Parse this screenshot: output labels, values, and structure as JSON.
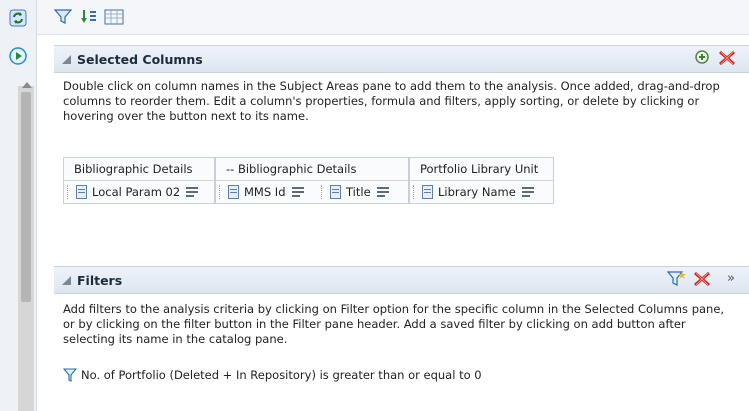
{
  "selected_columns": {
    "title": "Selected Columns",
    "description": "Double click on column names in the Subject Areas pane to add them to the analysis. Once added, drag-and-drop columns to reorder them. Edit a column's properties, formula and filters, apply sorting, or delete by clicking or hovering over the button next to its name.",
    "groups": [
      {
        "header": "Bibliographic Details",
        "columns": [
          "Local Param 02"
        ]
      },
      {
        "header": "-- Bibliographic Details",
        "columns": [
          "MMS Id",
          "Title"
        ]
      },
      {
        "header": "Portfolio Library Unit",
        "columns": [
          "Library Name"
        ]
      }
    ]
  },
  "filters": {
    "title": "Filters",
    "description": "Add filters to the analysis criteria by clicking on Filter option for the specific column in the Selected Columns pane, or by clicking on the filter button in the Filter pane header. Add a saved filter by clicking on add button after selecting its name in the catalog pane.",
    "filter_text": "No. of Portfolio (Deleted + In Repository)  is greater than or equal to  0",
    "more_glyph": "»"
  }
}
